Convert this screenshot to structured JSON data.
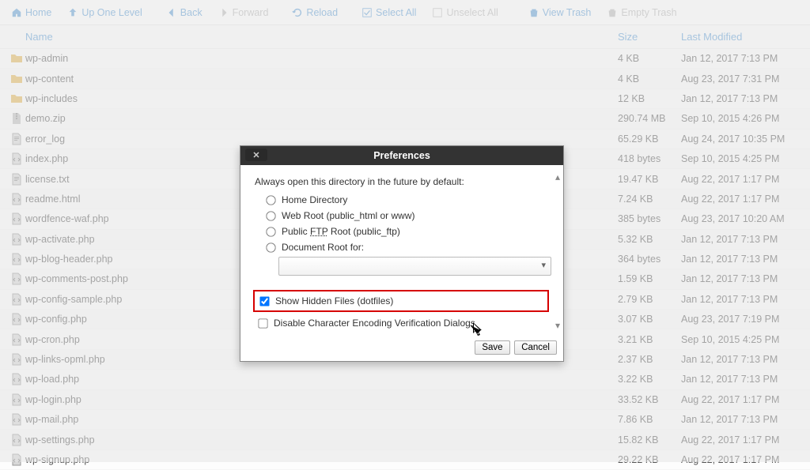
{
  "toolbar": {
    "home": "Home",
    "up": "Up One Level",
    "back": "Back",
    "forward": "Forward",
    "reload": "Reload",
    "select_all": "Select All",
    "unselect_all": "Unselect All",
    "view_trash": "View Trash",
    "empty_trash": "Empty Trash"
  },
  "table": {
    "headers": {
      "name": "Name",
      "size": "Size",
      "modified": "Last Modified"
    },
    "rows": [
      {
        "icon": "folder",
        "name": "wp-admin",
        "size": "4 KB",
        "modified": "Jan 12, 2017 7:13 PM"
      },
      {
        "icon": "folder",
        "name": "wp-content",
        "size": "4 KB",
        "modified": "Aug 23, 2017 7:31 PM"
      },
      {
        "icon": "folder",
        "name": "wp-includes",
        "size": "12 KB",
        "modified": "Jan 12, 2017 7:13 PM"
      },
      {
        "icon": "zip",
        "name": "demo.zip",
        "size": "290.74 MB",
        "modified": "Sep 10, 2015 4:26 PM"
      },
      {
        "icon": "file",
        "name": "error_log",
        "size": "65.29 KB",
        "modified": "Aug 24, 2017 10:35 PM"
      },
      {
        "icon": "code",
        "name": "index.php",
        "size": "418 bytes",
        "modified": "Sep 10, 2015 4:25 PM"
      },
      {
        "icon": "file",
        "name": "license.txt",
        "size": "19.47 KB",
        "modified": "Aug 22, 2017 1:17 PM"
      },
      {
        "icon": "code",
        "name": "readme.html",
        "size": "7.24 KB",
        "modified": "Aug 22, 2017 1:17 PM"
      },
      {
        "icon": "code",
        "name": "wordfence-waf.php",
        "size": "385 bytes",
        "modified": "Aug 23, 2017 10:20 AM"
      },
      {
        "icon": "code",
        "name": "wp-activate.php",
        "size": "5.32 KB",
        "modified": "Jan 12, 2017 7:13 PM"
      },
      {
        "icon": "code",
        "name": "wp-blog-header.php",
        "size": "364 bytes",
        "modified": "Jan 12, 2017 7:13 PM"
      },
      {
        "icon": "code",
        "name": "wp-comments-post.php",
        "size": "1.59 KB",
        "modified": "Jan 12, 2017 7:13 PM"
      },
      {
        "icon": "code",
        "name": "wp-config-sample.php",
        "size": "2.79 KB",
        "modified": "Jan 12, 2017 7:13 PM"
      },
      {
        "icon": "code",
        "name": "wp-config.php",
        "size": "3.07 KB",
        "modified": "Aug 23, 2017 7:19 PM"
      },
      {
        "icon": "code",
        "name": "wp-cron.php",
        "size": "3.21 KB",
        "modified": "Sep 10, 2015 4:25 PM"
      },
      {
        "icon": "code",
        "name": "wp-links-opml.php",
        "size": "2.37 KB",
        "modified": "Jan 12, 2017 7:13 PM"
      },
      {
        "icon": "code",
        "name": "wp-load.php",
        "size": "3.22 KB",
        "modified": "Jan 12, 2017 7:13 PM"
      },
      {
        "icon": "code",
        "name": "wp-login.php",
        "size": "33.52 KB",
        "modified": "Aug 22, 2017 1:17 PM"
      },
      {
        "icon": "code",
        "name": "wp-mail.php",
        "size": "7.86 KB",
        "modified": "Jan 12, 2017 7:13 PM"
      },
      {
        "icon": "code",
        "name": "wp-settings.php",
        "size": "15.82 KB",
        "modified": "Aug 22, 2017 1:17 PM"
      },
      {
        "icon": "code",
        "name": "wp-signup.php",
        "size": "29.22 KB",
        "modified": "Aug 22, 2017 1:17 PM"
      }
    ]
  },
  "dialog": {
    "title": "Preferences",
    "lead": "Always open this directory in the future by default:",
    "opt_home": "Home Directory",
    "opt_webroot": "Web Root (public_html or www)",
    "opt_ftp_pre": "Public ",
    "opt_ftp_u": "FTP",
    "opt_ftp_post": " Root (public_ftp)",
    "opt_docroot": "Document Root for:",
    "chk_hidden": "Show Hidden Files (dotfiles)",
    "chk_encoding": "Disable Character Encoding Verification Dialogs",
    "save": "Save",
    "cancel": "Cancel"
  }
}
